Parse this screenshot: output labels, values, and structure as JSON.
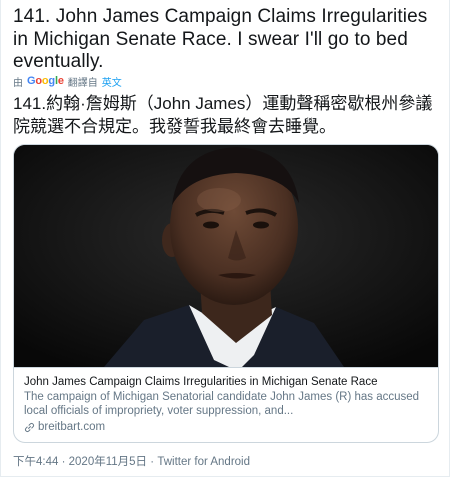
{
  "tweet": {
    "text": "141. John James Campaign Claims Irregularities in Michigan Senate Race. I swear I'll go to bed eventually.",
    "translation_prefix": "由",
    "translation_provider_g1": "G",
    "translation_provider_o1": "o",
    "translation_provider_o2": "o",
    "translation_provider_g2": "g",
    "translation_provider_l": "l",
    "translation_provider_e": "e",
    "translation_label": "翻譯自",
    "translation_source_lang": "英文",
    "translated_text": "141.約翰·詹姆斯（John James）運動聲稱密歇根州參議院競選不合規定。我發誓我最終會去睡覺。"
  },
  "card": {
    "title": "John James Campaign Claims Irregularities in Michigan Senate Race",
    "description": "The campaign of Michigan Senatorial candidate John James (R) has accused local officials of impropriety, voter suppression, and...",
    "domain": "breitbart.com"
  },
  "meta": {
    "time": "下午4:44",
    "separator1": "·",
    "date": "2020年11月5日",
    "separator2": "·",
    "client": "Twitter for Android"
  },
  "colors": {
    "text": "#14171a",
    "secondary": "#657786",
    "link": "#1da1f2",
    "border": "#ccd6dd"
  }
}
